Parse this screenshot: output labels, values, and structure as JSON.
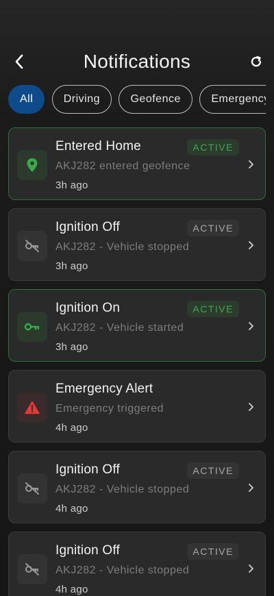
{
  "header": {
    "title": "Notifications"
  },
  "filters": [
    {
      "label": "All",
      "active": true
    },
    {
      "label": "Driving",
      "active": false
    },
    {
      "label": "Geofence",
      "active": false
    },
    {
      "label": "Emergency",
      "active": false
    }
  ],
  "notifications": [
    {
      "title": "Entered Home",
      "subtitle": "AKJ282 entered geofence",
      "time": "3h ago",
      "badge": "ACTIVE",
      "badge_color": "green",
      "icon": "location-pin-icon",
      "icon_color": "#3daa4a",
      "border": "green"
    },
    {
      "title": "Ignition Off",
      "subtitle": "AKJ282 - Vehicle stopped",
      "time": "3h ago",
      "badge": "ACTIVE",
      "badge_color": "gray",
      "icon": "key-off-icon",
      "icon_color": "#9a9a9a",
      "border": "gray"
    },
    {
      "title": "Ignition On",
      "subtitle": "AKJ282 - Vehicle started",
      "time": "3h ago",
      "badge": "ACTIVE",
      "badge_color": "green",
      "icon": "key-icon",
      "icon_color": "#3daa4a",
      "border": "green"
    },
    {
      "title": "Emergency Alert",
      "subtitle": "Emergency triggered",
      "time": "4h ago",
      "badge": "",
      "badge_color": "",
      "icon": "warning-icon",
      "icon_color": "#e03a3a",
      "border": "gray"
    },
    {
      "title": "Ignition Off",
      "subtitle": "AKJ282 - Vehicle stopped",
      "time": "4h ago",
      "badge": "ACTIVE",
      "badge_color": "gray",
      "icon": "key-off-icon",
      "icon_color": "#9a9a9a",
      "border": "gray"
    },
    {
      "title": "Ignition Off",
      "subtitle": "AKJ282 - Vehicle stopped",
      "time": "4h ago",
      "badge": "ACTIVE",
      "badge_color": "gray",
      "icon": "key-off-icon",
      "icon_color": "#9a9a9a",
      "border": "gray"
    }
  ],
  "colors": {
    "accent": "#0f4a8a",
    "active_green": "#3daa4a",
    "alert_red": "#e03a3a"
  }
}
